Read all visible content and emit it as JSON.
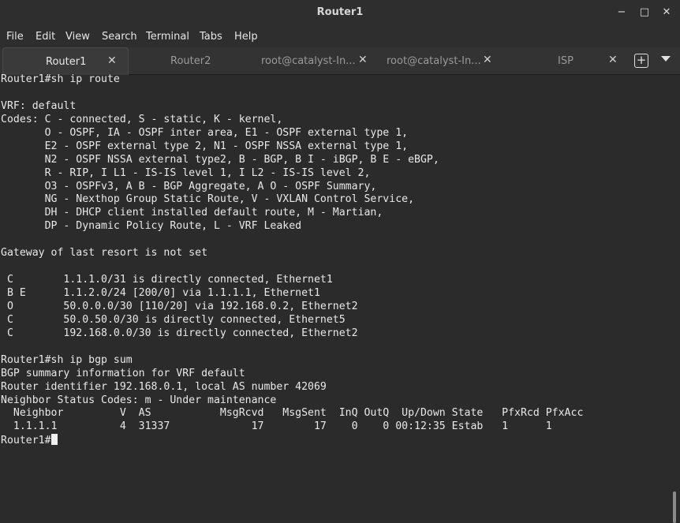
{
  "window": {
    "title": "Router1",
    "controls": {
      "minimize": "−",
      "maximize": "□",
      "close": "✕"
    }
  },
  "menu": [
    "File",
    "Edit",
    "View",
    "Search",
    "Terminal",
    "Tabs",
    "Help"
  ],
  "tabs": [
    {
      "label": "Router1",
      "active": true,
      "close": "✕"
    },
    {
      "label": "Router2",
      "active": false,
      "close": ""
    },
    {
      "label": "root@catalyst-In...",
      "active": false,
      "close": "✕"
    },
    {
      "label": "root@catalyst-In...",
      "active": false,
      "close": "✕"
    },
    {
      "label": "ISP",
      "active": false,
      "close": "✕"
    }
  ],
  "tabbar": {
    "new_tab": "+",
    "menu_icon": "chevron-down-icon"
  },
  "terminal": {
    "lines": [
      "Router1#sh ip route",
      "",
      "VRF: default",
      "Codes: C - connected, S - static, K - kernel,",
      "       O - OSPF, IA - OSPF inter area, E1 - OSPF external type 1,",
      "       E2 - OSPF external type 2, N1 - OSPF NSSA external type 1,",
      "       N2 - OSPF NSSA external type2, B - BGP, B I - iBGP, B E - eBGP,",
      "       R - RIP, I L1 - IS-IS level 1, I L2 - IS-IS level 2,",
      "       O3 - OSPFv3, A B - BGP Aggregate, A O - OSPF Summary,",
      "       NG - Nexthop Group Static Route, V - VXLAN Control Service,",
      "       DH - DHCP client installed default route, M - Martian,",
      "       DP - Dynamic Policy Route, L - VRF Leaked",
      "",
      "Gateway of last resort is not set",
      "",
      " C        1.1.1.0/31 is directly connected, Ethernet1",
      " B E      1.1.2.0/24 [200/0] via 1.1.1.1, Ethernet1",
      " O        50.0.0.0/30 [110/20] via 192.168.0.2, Ethernet2",
      " C        50.0.50.0/30 is directly connected, Ethernet5",
      " C        192.168.0.0/30 is directly connected, Ethernet2",
      "",
      "Router1#sh ip bgp sum",
      "BGP summary information for VRF default",
      "Router identifier 192.168.0.1, local AS number 42069",
      "Neighbor Status Codes: m - Under maintenance",
      "  Neighbor         V  AS           MsgRcvd   MsgSent  InQ OutQ  Up/Down State   PfxRcd PfxAcc",
      "  1.1.1.1          4  31337             17        17    0    0 00:12:35 Estab   1      1"
    ],
    "prompt": "Router1#"
  }
}
